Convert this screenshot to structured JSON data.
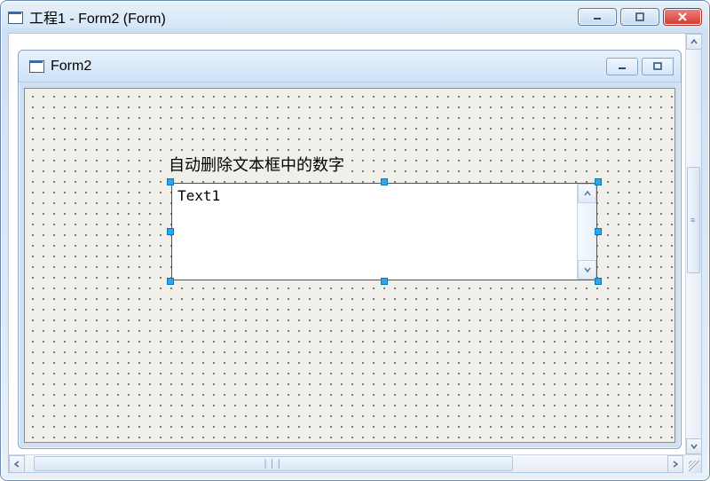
{
  "outer": {
    "title": "工程1 - Form2 (Form)"
  },
  "inner": {
    "title": "Form2"
  },
  "form": {
    "label_caption": "自动删除文本框中的数字",
    "textbox_value": "Text1"
  }
}
